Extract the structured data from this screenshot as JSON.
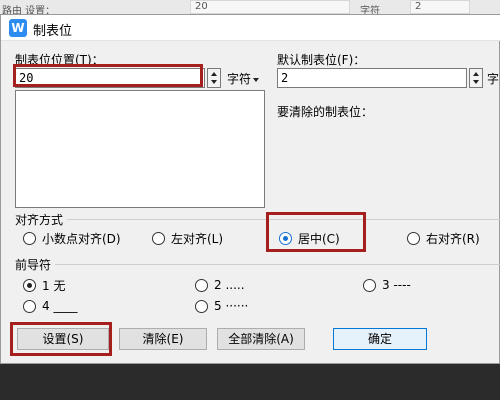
{
  "background": {
    "left_text": "路由 设置：",
    "box_value": "20",
    "unit": "字符",
    "right_value": "2"
  },
  "dialog": {
    "title": "制表位",
    "tab_position_label": "制表位位置(T)：",
    "tab_position_value": "20",
    "unit": "字符",
    "default_tab_label": "默认制表位(F)：",
    "default_tab_value": "2",
    "default_unit": "字",
    "clear_label": "要清除的制表位：",
    "alignment": {
      "title": "对齐方式",
      "options": [
        "小数点对齐(D)",
        "左对齐(L)",
        "居中(C)",
        "右对齐(R)"
      ],
      "selected": "居中(C)"
    },
    "leader": {
      "title": "前导符",
      "options": [
        "1 无",
        "2 .....",
        "3 ----",
        "4 ____",
        "5 ······"
      ],
      "selected": "1 无"
    },
    "buttons": {
      "set": "设置(S)",
      "clear": "清除(E)",
      "clear_all": "全部清除(A)",
      "ok": "确定"
    }
  },
  "colors": {
    "highlight": "#a51f1f",
    "accent": "#1a6fd3"
  }
}
